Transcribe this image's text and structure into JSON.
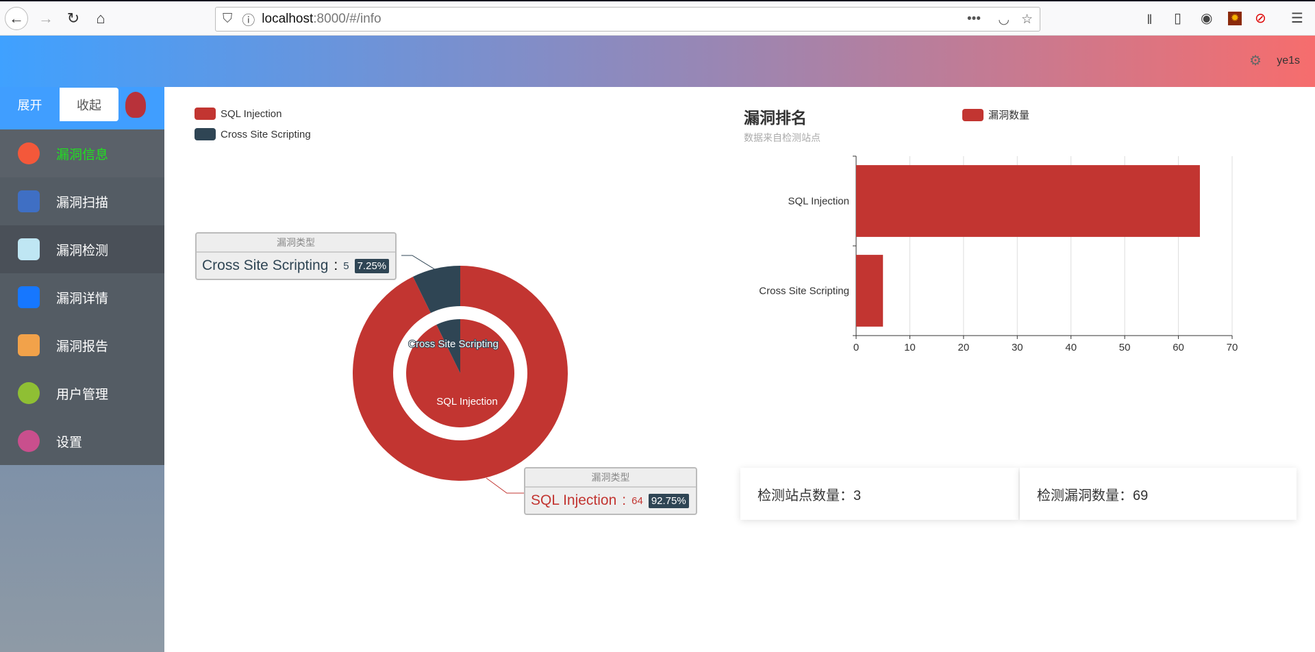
{
  "browser": {
    "url_host": "localhost",
    "url_rest": ":8000/#/info"
  },
  "header": {
    "user": "ye1s"
  },
  "sidebar": {
    "expand": "展开",
    "collapse": "收起",
    "items": [
      {
        "label": "漏洞信息",
        "icon": "shield-bolt-icon",
        "color": "#f4583a"
      },
      {
        "label": "漏洞扫描",
        "icon": "bug-search-icon",
        "color": "#3f6fc4"
      },
      {
        "label": "漏洞检测",
        "icon": "bug-detect-icon",
        "color": "#bfe6f3"
      },
      {
        "label": "漏洞详情",
        "icon": "document-search-icon",
        "color": "#1677ff"
      },
      {
        "label": "漏洞报告",
        "icon": "report-icon",
        "color": "#f2a24a"
      },
      {
        "label": "用户管理",
        "icon": "user-icon",
        "color": "#8fbf34"
      },
      {
        "label": "设置",
        "icon": "settings-icon",
        "color": "#c94f8d"
      }
    ]
  },
  "pie": {
    "legend": [
      "SQL Injection",
      "Cross Site Scripting"
    ],
    "tooltip_title": "漏洞类型",
    "tooltips": [
      {
        "name": "Cross Site Scripting",
        "value": "5",
        "pct": "7.25%"
      },
      {
        "name": "SQL Injection",
        "value": "64",
        "pct": "92.75%"
      }
    ]
  },
  "bar": {
    "title": "漏洞排名",
    "subtitle": "数据来自检测站点",
    "legend": "漏洞数量"
  },
  "stats": {
    "sites": "检测站点数量：3",
    "vulns": "检测漏洞数量：69"
  },
  "chart_data": [
    {
      "type": "pie",
      "categories": [
        "SQL Injection",
        "Cross Site Scripting"
      ],
      "values": [
        64,
        5
      ],
      "colors": [
        "#c23531",
        "#2f4554"
      ],
      "legend_placement": "top-left"
    },
    {
      "type": "bar",
      "orientation": "horizontal",
      "title": "漏洞排名",
      "subtitle": "数据来自检测站点",
      "categories": [
        "SQL Injection",
        "Cross Site Scripting"
      ],
      "series": [
        {
          "name": "漏洞数量",
          "values": [
            64,
            5
          ]
        }
      ],
      "xlim": [
        0,
        70
      ],
      "xticks": [
        "0",
        "10",
        "20",
        "30",
        "40",
        "50",
        "60",
        "70"
      ],
      "grid": true,
      "color": "#c23531"
    }
  ]
}
